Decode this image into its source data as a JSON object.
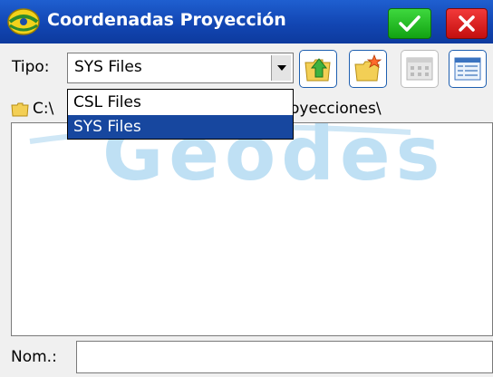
{
  "window": {
    "title": "Coordenadas Proyección",
    "ok_icon": "checkmark-icon",
    "close_icon": "close-icon"
  },
  "toolbar": {
    "tipo_label": "Tipo:",
    "tipo_value": "SYS Files",
    "buttons": [
      "folder-up-icon",
      "new-folder-icon",
      "small-icons-view-icon",
      "details-view-icon"
    ]
  },
  "path": {
    "prefix": "C:\\",
    "suffix": "oyecciones\\"
  },
  "dropdown": {
    "options": [
      "CSL Files",
      "SYS Files"
    ],
    "selected": "SYS Files"
  },
  "watermark": "Geodes",
  "name_field": {
    "label": "Nom.:",
    "value": ""
  },
  "colors": {
    "titlebar": "#1246b3",
    "ok": "#1fb81f",
    "close": "#d21414",
    "selection": "#17479f",
    "watermark": "#bfe0f4"
  }
}
